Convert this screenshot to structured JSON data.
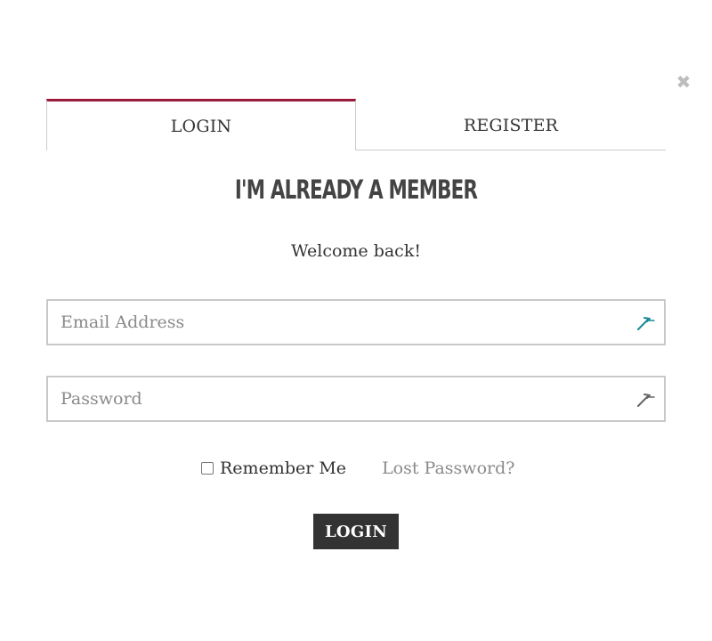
{
  "modal": {
    "close_icon": "close-icon"
  },
  "tabs": [
    {
      "label": "LOGIN",
      "active": true
    },
    {
      "label": "REGISTER",
      "active": false
    }
  ],
  "form": {
    "heading": "I'M ALREADY A MEMBER",
    "welcome": "Welcome back!",
    "email": {
      "placeholder": "Email Address",
      "value": "",
      "icon": "password-manager-icon",
      "icon_color": "#1a8a9a"
    },
    "password": {
      "placeholder": "Password",
      "value": "",
      "icon": "password-manager-icon",
      "icon_color": "#666666"
    },
    "remember_label": "Remember Me",
    "remember_checked": false,
    "lost_password": "Lost Password?",
    "submit_label": "LOGIN"
  },
  "colors": {
    "accent": "#9b1c3a",
    "button_bg": "#333333"
  }
}
